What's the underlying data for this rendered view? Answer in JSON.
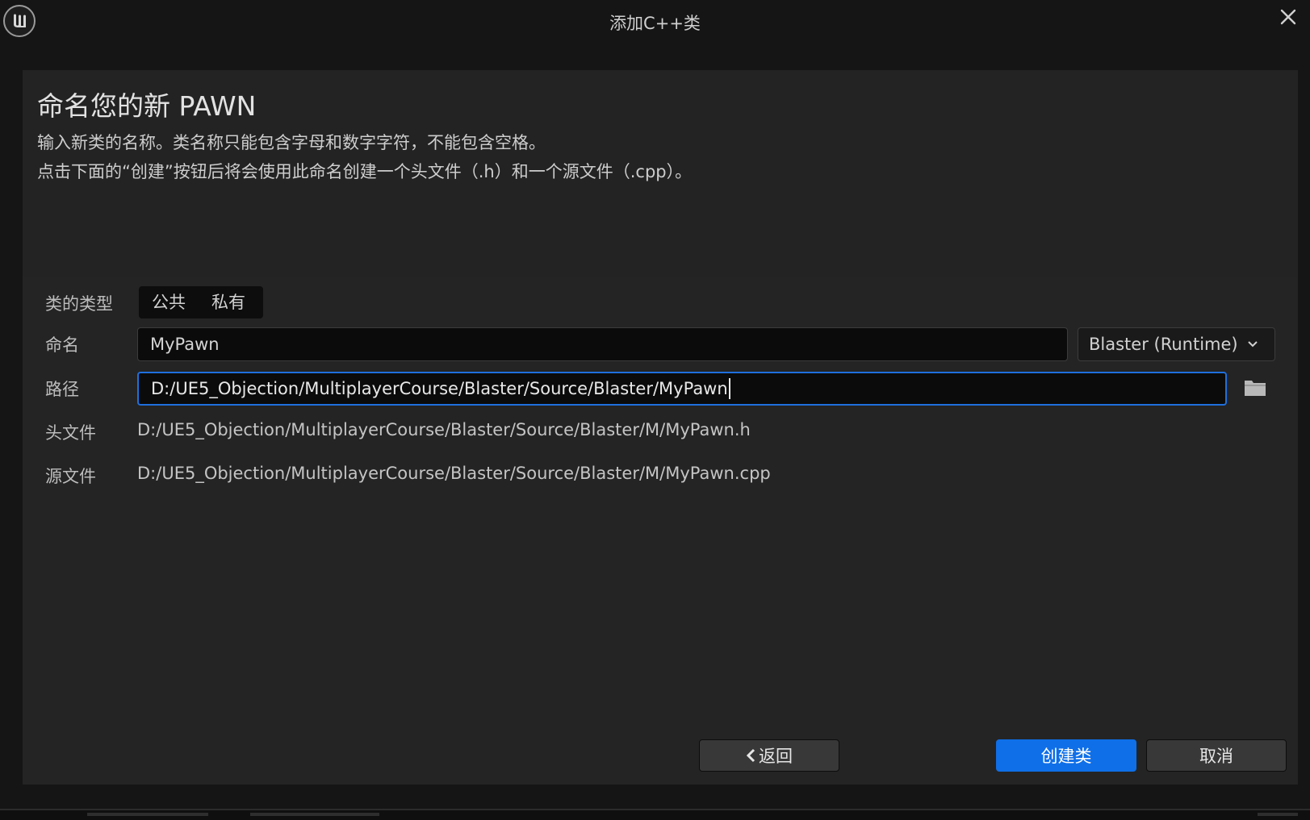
{
  "window": {
    "title": "添加C++类"
  },
  "header": {
    "title": "命名您的新 PAWN",
    "description_line1": "输入新类的名称。类名称只能包含字母和数字字符，不能包含空格。",
    "description_line2": "点击下面的“创建”按钮后将会使用此命名创建一个头文件（.h）和一个源文件（.cpp）。"
  },
  "form": {
    "class_type": {
      "label": "类的类型",
      "options": [
        "公共",
        "私有"
      ]
    },
    "name": {
      "label": "命名",
      "value": "MyPawn"
    },
    "module": {
      "selected": "Blaster (Runtime)"
    },
    "path": {
      "label": "路径",
      "value": "D:/UE5_Objection/MultiplayerCourse/Blaster/Source/Blaster/MyPawn"
    },
    "header_file": {
      "label": "头文件",
      "value": "D:/UE5_Objection/MultiplayerCourse/Blaster/Source/Blaster/M/MyPawn.h"
    },
    "source_file": {
      "label": "源文件",
      "value": "D:/UE5_Objection/MultiplayerCourse/Blaster/Source/Blaster/M/MyPawn.cpp"
    }
  },
  "footer": {
    "back_label": "返回",
    "create_label": "创建类",
    "cancel_label": "取消"
  },
  "icons": {
    "app_logo": "unreal-engine-logo-icon",
    "close": "close-icon",
    "dropdown": "chevron-down-icon",
    "folder": "folder-icon",
    "back": "chevron-left-icon"
  },
  "colors": {
    "accent": "#0f6fe8",
    "focus_border": "#1f6fdd",
    "panel_bg": "#242424",
    "window_bg": "#151515"
  }
}
